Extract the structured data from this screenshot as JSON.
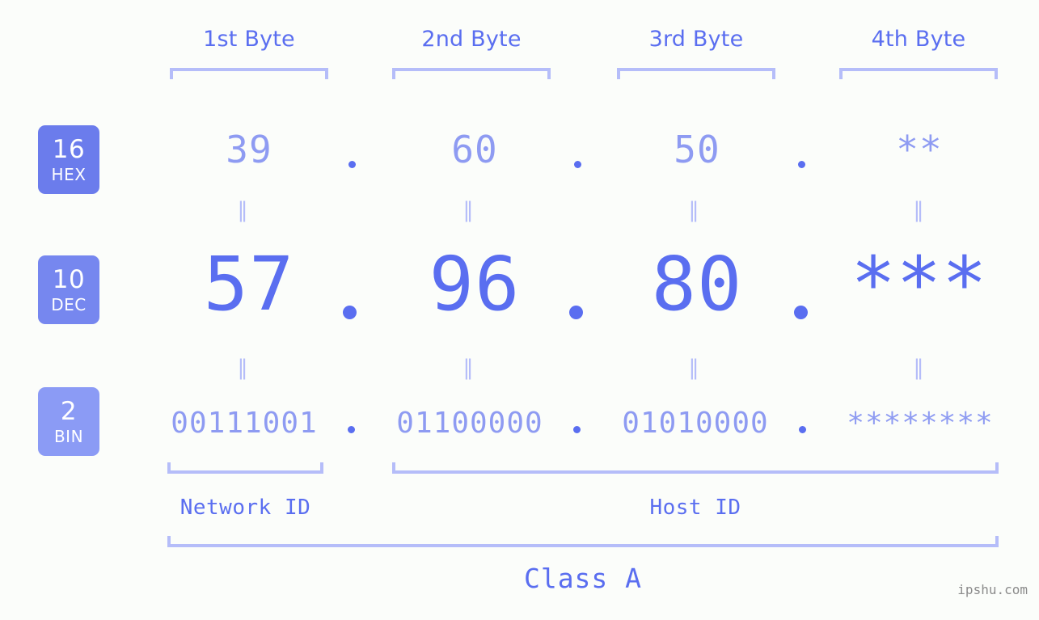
{
  "meta": {
    "background": "#fbfdfa",
    "accent": "#5a6ef0",
    "accent_light": "#8e9bf2",
    "accent_pale": "#b5bdf9",
    "badge_color": "#6b7cec",
    "badge_color_light": "#8b9bf5"
  },
  "headers": [
    {
      "label": "1st Byte"
    },
    {
      "label": "2nd Byte"
    },
    {
      "label": "3rd Byte"
    },
    {
      "label": "4th Byte"
    }
  ],
  "rows": [
    {
      "radix": "16",
      "radix_name": "HEX",
      "values": [
        "39",
        "60",
        "50",
        "**"
      ]
    },
    {
      "radix": "10",
      "radix_name": "DEC",
      "values": [
        "57",
        "96",
        "80",
        "***"
      ]
    },
    {
      "radix": "2",
      "radix_name": "BIN",
      "values": [
        "00111001",
        "01100000",
        "01010000",
        "********"
      ]
    }
  ],
  "separators": {
    "dot": ".",
    "equality": "‖"
  },
  "segments": {
    "network_id": "Network ID",
    "host_id": "Host ID",
    "class": "Class A"
  },
  "watermark": "ipshu.com"
}
